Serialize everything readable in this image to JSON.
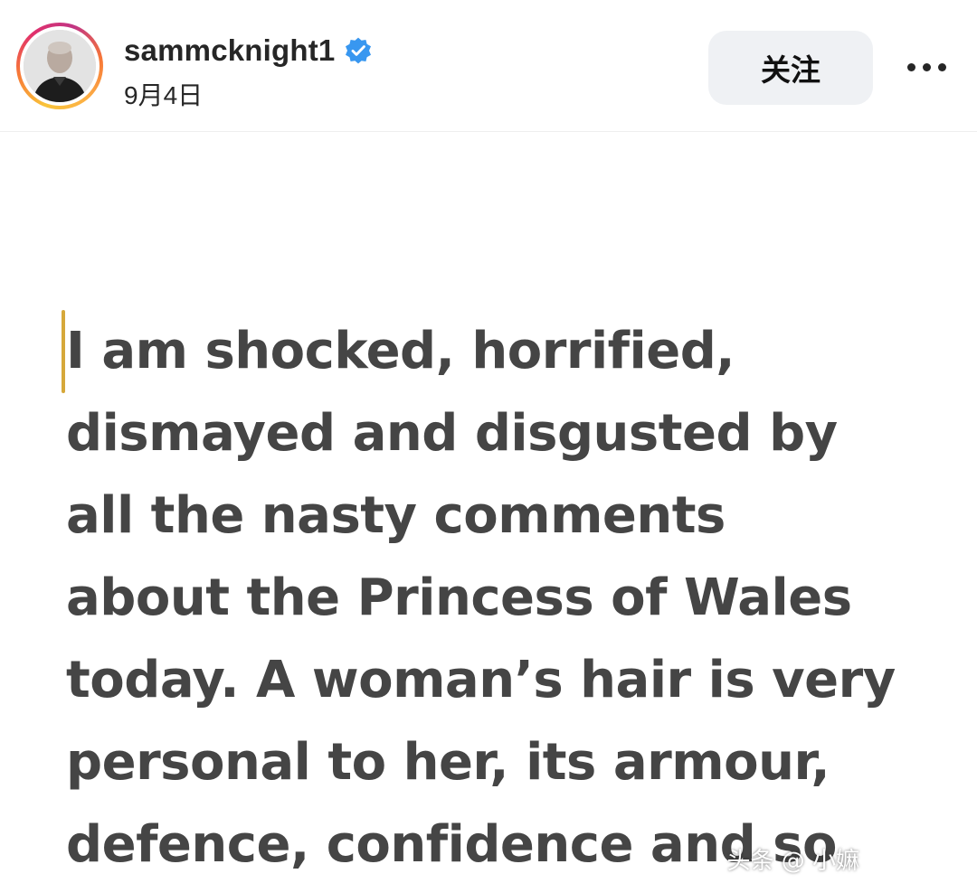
{
  "header": {
    "username": "sammcknight1",
    "date": "9月4日",
    "follow_label": "关注",
    "verified_icon": "verified-badge-icon",
    "more_icon": "more-options-icon"
  },
  "post": {
    "lines": [
      "I am shocked, horrified,",
      "dismayed and disgusted by",
      "all the nasty comments",
      "about the Princess of Wales",
      "today. A woman’s hair is very",
      "personal to her, its armour,",
      "defence, confidence and so"
    ],
    "watermark": "头条 @ 小嫲"
  },
  "colors": {
    "verified": "#3897f0",
    "text": "#454545",
    "caret": "#d6a83a",
    "follow_bg": "#eff1f4"
  }
}
